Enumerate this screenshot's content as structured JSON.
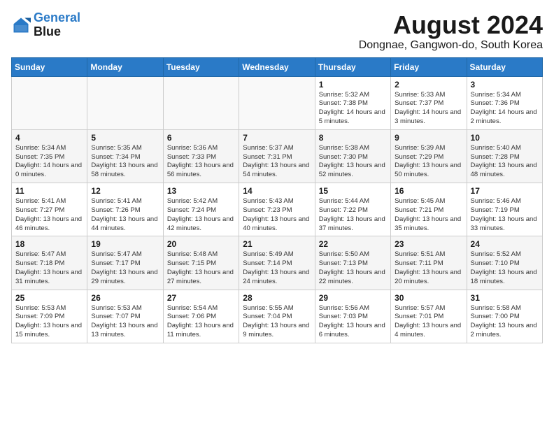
{
  "header": {
    "logo": {
      "line1": "General",
      "line2": "Blue"
    },
    "title": "August 2024",
    "location": "Dongnae, Gangwon-do, South Korea"
  },
  "weekdays": [
    "Sunday",
    "Monday",
    "Tuesday",
    "Wednesday",
    "Thursday",
    "Friday",
    "Saturday"
  ],
  "weeks": [
    [
      {
        "day": "",
        "content": ""
      },
      {
        "day": "",
        "content": ""
      },
      {
        "day": "",
        "content": ""
      },
      {
        "day": "",
        "content": ""
      },
      {
        "day": "1",
        "content": "Sunrise: 5:32 AM\nSunset: 7:38 PM\nDaylight: 14 hours\nand 5 minutes."
      },
      {
        "day": "2",
        "content": "Sunrise: 5:33 AM\nSunset: 7:37 PM\nDaylight: 14 hours\nand 3 minutes."
      },
      {
        "day": "3",
        "content": "Sunrise: 5:34 AM\nSunset: 7:36 PM\nDaylight: 14 hours\nand 2 minutes."
      }
    ],
    [
      {
        "day": "4",
        "content": "Sunrise: 5:34 AM\nSunset: 7:35 PM\nDaylight: 14 hours\nand 0 minutes."
      },
      {
        "day": "5",
        "content": "Sunrise: 5:35 AM\nSunset: 7:34 PM\nDaylight: 13 hours\nand 58 minutes."
      },
      {
        "day": "6",
        "content": "Sunrise: 5:36 AM\nSunset: 7:33 PM\nDaylight: 13 hours\nand 56 minutes."
      },
      {
        "day": "7",
        "content": "Sunrise: 5:37 AM\nSunset: 7:31 PM\nDaylight: 13 hours\nand 54 minutes."
      },
      {
        "day": "8",
        "content": "Sunrise: 5:38 AM\nSunset: 7:30 PM\nDaylight: 13 hours\nand 52 minutes."
      },
      {
        "day": "9",
        "content": "Sunrise: 5:39 AM\nSunset: 7:29 PM\nDaylight: 13 hours\nand 50 minutes."
      },
      {
        "day": "10",
        "content": "Sunrise: 5:40 AM\nSunset: 7:28 PM\nDaylight: 13 hours\nand 48 minutes."
      }
    ],
    [
      {
        "day": "11",
        "content": "Sunrise: 5:41 AM\nSunset: 7:27 PM\nDaylight: 13 hours\nand 46 minutes."
      },
      {
        "day": "12",
        "content": "Sunrise: 5:41 AM\nSunset: 7:26 PM\nDaylight: 13 hours\nand 44 minutes."
      },
      {
        "day": "13",
        "content": "Sunrise: 5:42 AM\nSunset: 7:24 PM\nDaylight: 13 hours\nand 42 minutes."
      },
      {
        "day": "14",
        "content": "Sunrise: 5:43 AM\nSunset: 7:23 PM\nDaylight: 13 hours\nand 40 minutes."
      },
      {
        "day": "15",
        "content": "Sunrise: 5:44 AM\nSunset: 7:22 PM\nDaylight: 13 hours\nand 37 minutes."
      },
      {
        "day": "16",
        "content": "Sunrise: 5:45 AM\nSunset: 7:21 PM\nDaylight: 13 hours\nand 35 minutes."
      },
      {
        "day": "17",
        "content": "Sunrise: 5:46 AM\nSunset: 7:19 PM\nDaylight: 13 hours\nand 33 minutes."
      }
    ],
    [
      {
        "day": "18",
        "content": "Sunrise: 5:47 AM\nSunset: 7:18 PM\nDaylight: 13 hours\nand 31 minutes."
      },
      {
        "day": "19",
        "content": "Sunrise: 5:47 AM\nSunset: 7:17 PM\nDaylight: 13 hours\nand 29 minutes."
      },
      {
        "day": "20",
        "content": "Sunrise: 5:48 AM\nSunset: 7:15 PM\nDaylight: 13 hours\nand 27 minutes."
      },
      {
        "day": "21",
        "content": "Sunrise: 5:49 AM\nSunset: 7:14 PM\nDaylight: 13 hours\nand 24 minutes."
      },
      {
        "day": "22",
        "content": "Sunrise: 5:50 AM\nSunset: 7:13 PM\nDaylight: 13 hours\nand 22 minutes."
      },
      {
        "day": "23",
        "content": "Sunrise: 5:51 AM\nSunset: 7:11 PM\nDaylight: 13 hours\nand 20 minutes."
      },
      {
        "day": "24",
        "content": "Sunrise: 5:52 AM\nSunset: 7:10 PM\nDaylight: 13 hours\nand 18 minutes."
      }
    ],
    [
      {
        "day": "25",
        "content": "Sunrise: 5:53 AM\nSunset: 7:09 PM\nDaylight: 13 hours\nand 15 minutes."
      },
      {
        "day": "26",
        "content": "Sunrise: 5:53 AM\nSunset: 7:07 PM\nDaylight: 13 hours\nand 13 minutes."
      },
      {
        "day": "27",
        "content": "Sunrise: 5:54 AM\nSunset: 7:06 PM\nDaylight: 13 hours\nand 11 minutes."
      },
      {
        "day": "28",
        "content": "Sunrise: 5:55 AM\nSunset: 7:04 PM\nDaylight: 13 hours\nand 9 minutes."
      },
      {
        "day": "29",
        "content": "Sunrise: 5:56 AM\nSunset: 7:03 PM\nDaylight: 13 hours\nand 6 minutes."
      },
      {
        "day": "30",
        "content": "Sunrise: 5:57 AM\nSunset: 7:01 PM\nDaylight: 13 hours\nand 4 minutes."
      },
      {
        "day": "31",
        "content": "Sunrise: 5:58 AM\nSunset: 7:00 PM\nDaylight: 13 hours\nand 2 minutes."
      }
    ]
  ]
}
